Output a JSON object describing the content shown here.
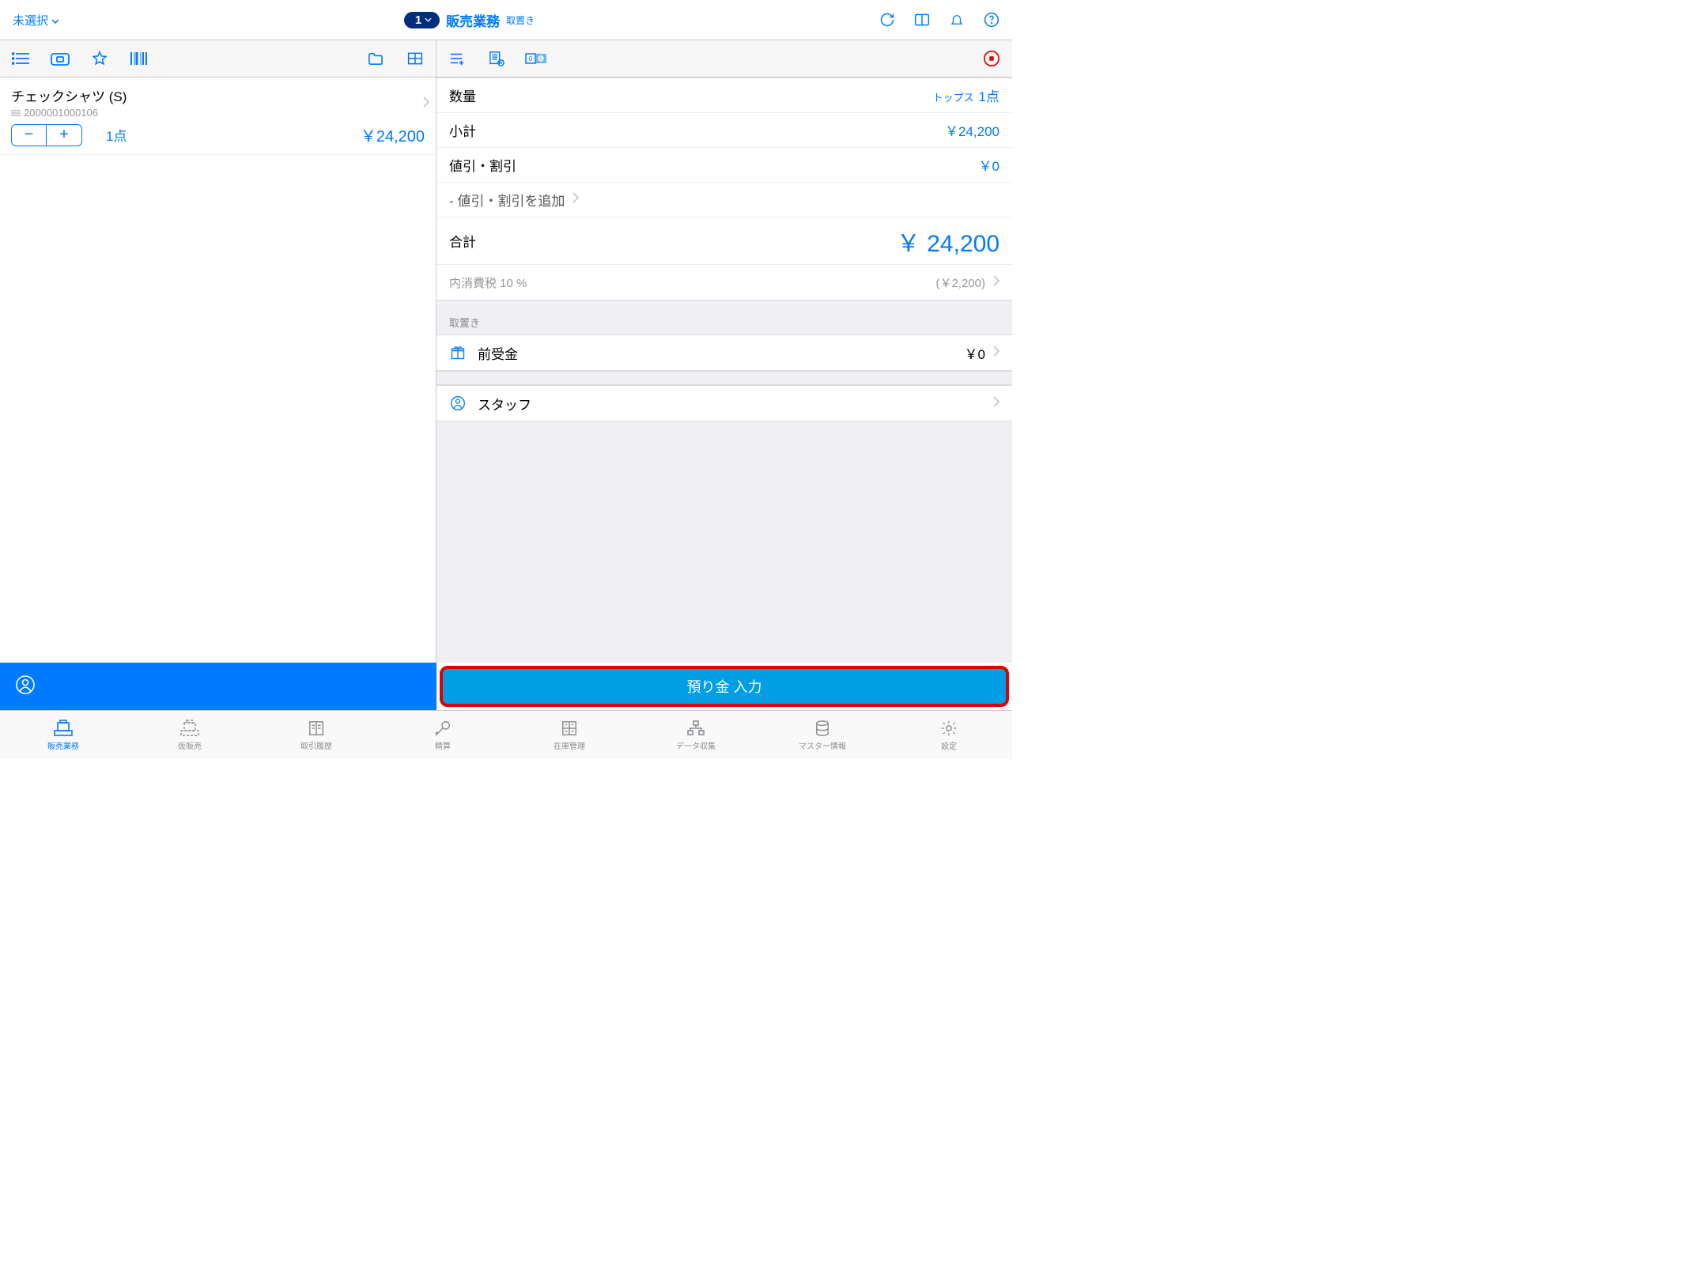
{
  "header": {
    "unselected": "未選択",
    "mode_badge": "1",
    "mode_title": "販売業務",
    "mode_sub": "取置き"
  },
  "cart": {
    "item": {
      "name": "チェックシャツ (S)",
      "sku": "2000001000106",
      "qty_text": "1点",
      "price": "￥24,200"
    }
  },
  "summary": {
    "qty_label": "数量",
    "qty_category": "トップス",
    "qty_count": "1点",
    "subtotal_label": "小計",
    "subtotal_value": "￥24,200",
    "discount_label": "値引・割引",
    "discount_value": "￥0",
    "add_discount": "- 値引・割引を追加",
    "total_label": "合計",
    "total_value": "￥ 24,200",
    "tax_label": "内消費税 10 %",
    "tax_value": "(￥2,200)",
    "layaway_header": "取置き",
    "deposit_label": "前受金",
    "deposit_value": "￥0",
    "staff_label": "スタッフ"
  },
  "footer": {
    "pay_button": "預り金 入力"
  },
  "tabs": [
    {
      "label": "販売業務",
      "active": true
    },
    {
      "label": "仮販売",
      "active": false
    },
    {
      "label": "取引履歴",
      "active": false
    },
    {
      "label": "精算",
      "active": false
    },
    {
      "label": "在庫管理",
      "active": false
    },
    {
      "label": "データ収集",
      "active": false
    },
    {
      "label": "マスター情報",
      "active": false
    },
    {
      "label": "設定",
      "active": false
    }
  ]
}
